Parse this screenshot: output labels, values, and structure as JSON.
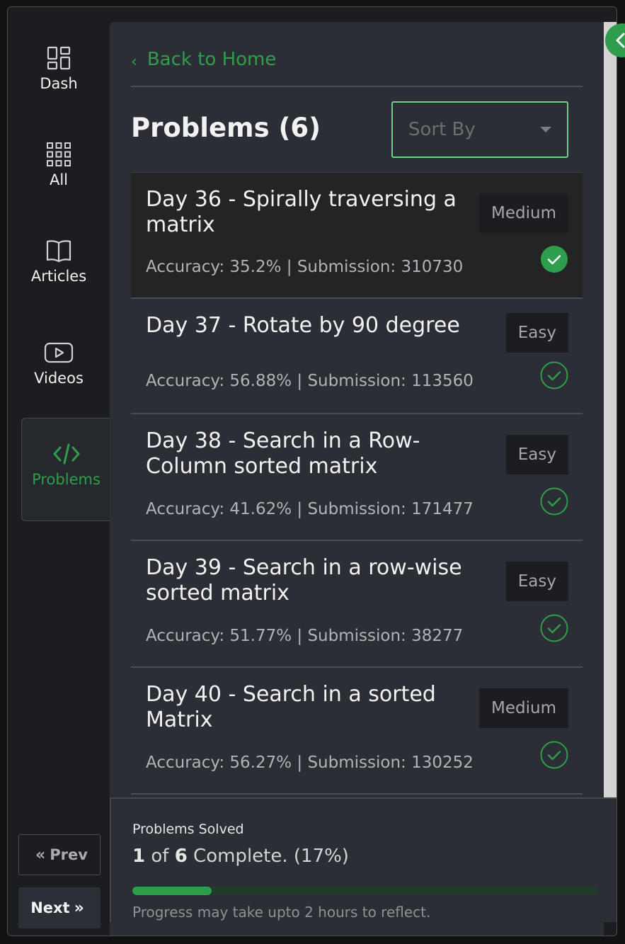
{
  "rail": {
    "items": [
      {
        "label": "Dash",
        "icon": "dashboard-icon"
      },
      {
        "label": "All",
        "icon": "grid-icon"
      },
      {
        "label": "Articles",
        "icon": "book-icon"
      },
      {
        "label": "Videos",
        "icon": "video-play-icon"
      },
      {
        "label": "Problems",
        "icon": "code-icon",
        "active": true
      }
    ],
    "prev_label": "Prev",
    "next_label": "Next"
  },
  "header": {
    "back_label": "Back to Home",
    "title": "Problems (6)",
    "sort_placeholder": "Sort By"
  },
  "problems": [
    {
      "name": "Day 36 - Spirally traversing a matrix",
      "difficulty": "Medium",
      "meta": "Accuracy: 35.2% | Submission: 310730",
      "solved": true
    },
    {
      "name": "Day 37 - Rotate by 90 degree",
      "difficulty": "Easy",
      "meta": "Accuracy: 56.88% | Submission: 113560",
      "solved": false
    },
    {
      "name": "Day 38 - Search in a Row-Column sorted matrix",
      "difficulty": "Easy",
      "meta": "Accuracy: 41.62% | Submission: 171477",
      "solved": false
    },
    {
      "name": "Day 39 - Search in a row-wise sorted matrix",
      "difficulty": "Easy",
      "meta": "Accuracy: 51.77% | Submission: 38277",
      "solved": false
    },
    {
      "name": "Day 40 - Search in a sorted Matrix",
      "difficulty": "Medium",
      "meta": "Accuracy: 56.27% | Submission: 130252",
      "solved": false
    }
  ],
  "summary": {
    "title": "Problems Solved",
    "solved": "1",
    "of_text": "of",
    "total": "6",
    "complete_text": "Complete. (17%)",
    "progress_percent": 17,
    "note": "Progress may take upto 2 hours to reflect."
  },
  "colors": {
    "accent": "#2f9e4c",
    "panel": "#2b2f35",
    "rail": "#1b1d20"
  }
}
